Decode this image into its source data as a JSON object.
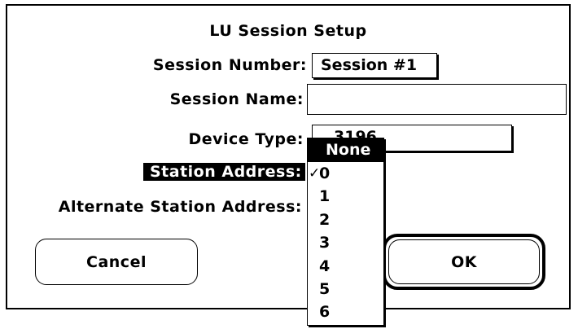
{
  "dialog": {
    "title": "LU Session Setup",
    "session_number_label": "Session Number:",
    "session_number_value": "Session #1",
    "session_name_label": "Session Name:",
    "session_name_value": "",
    "device_type_label": "Device Type:",
    "device_type_value": "3196",
    "station_address_label": "Station Address:",
    "alternate_station_address_label": "Alternate Station Address:",
    "cancel_label": "Cancel",
    "ok_label": "OK"
  },
  "station_menu": {
    "items": [
      {
        "label": "None",
        "state": "highlighted"
      },
      {
        "label": "0",
        "state": "checked",
        "check_mark": "✓"
      },
      {
        "label": "1"
      },
      {
        "label": "2"
      },
      {
        "label": "3"
      },
      {
        "label": "4"
      },
      {
        "label": "5"
      },
      {
        "label": "6"
      }
    ]
  }
}
